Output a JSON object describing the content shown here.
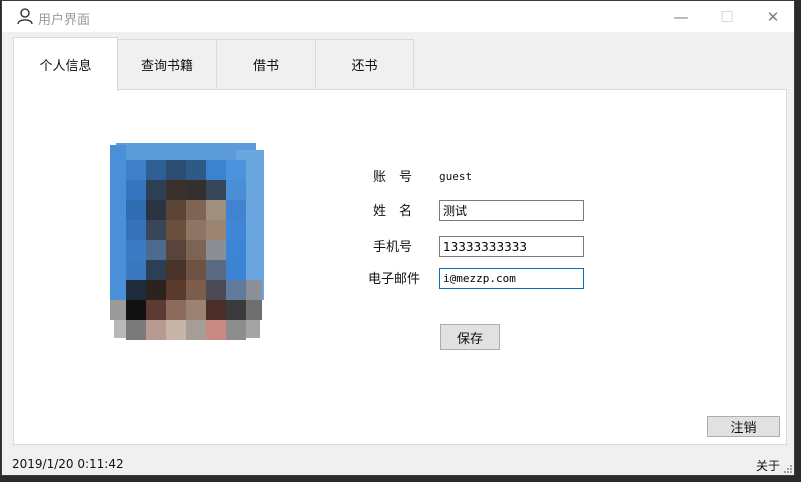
{
  "window": {
    "title": "用户界面",
    "minimize_glyph": "—",
    "maximize_glyph": "☐",
    "close_glyph": "✕"
  },
  "tabs": [
    {
      "label": "个人信息",
      "active": true
    },
    {
      "label": "查询书籍",
      "active": false
    },
    {
      "label": "借书",
      "active": false
    },
    {
      "label": "还书",
      "active": false
    }
  ],
  "profile": {
    "account_label": "账　号",
    "account_value": "guest",
    "name_label": "姓　名",
    "name_value": "测试",
    "phone_label": "手机号",
    "phone_value": "13333333333",
    "email_label": "电子邮件",
    "email_value": "i@mezzp.com",
    "save_label": "保存",
    "logout_label": "注销"
  },
  "status": {
    "datetime": "2019/1/20 0:11:42",
    "about_label": "关于"
  },
  "icons": {
    "title": "user-icon",
    "grip": "resize-grip-icon"
  },
  "colors": {
    "focus_border": "#0a6fc2",
    "button_face": "#e1e1e1",
    "window_bg": "#f0f0f0"
  }
}
